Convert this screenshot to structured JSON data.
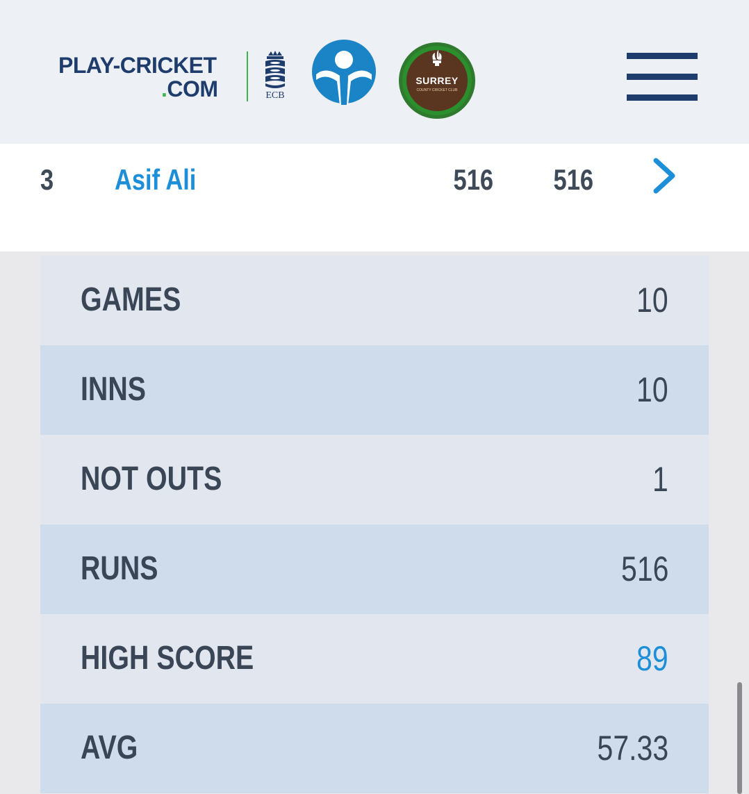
{
  "header": {
    "brand_line1": "PLAY-CRICKET",
    "brand_line2_dot": ".",
    "brand_line2": "COM",
    "ecb_label": "ECB",
    "club_name": "SURREY",
    "club_subtitle": "COUNTY CRICKET CLUB",
    "icons": [
      "play-cricket-logo",
      "ecb-logo",
      "natwest-logo",
      "surrey-club-badge",
      "hamburger-menu-icon"
    ],
    "colors": {
      "brand_navy": "#1f3d6c",
      "brand_green": "#3db34a",
      "link_blue": "#1d8fd8"
    }
  },
  "player": {
    "rank": "3",
    "name": "Asif Ali",
    "stat_a": "516",
    "stat_b": "516"
  },
  "stats": [
    {
      "label": "GAMES",
      "value": "10"
    },
    {
      "label": "INNS",
      "value": "10"
    },
    {
      "label": "NOT OUTS",
      "value": "1"
    },
    {
      "label": "RUNS",
      "value": "516"
    },
    {
      "label": "HIGH SCORE",
      "value": "89"
    },
    {
      "label": "AVG",
      "value": "57.33"
    }
  ]
}
